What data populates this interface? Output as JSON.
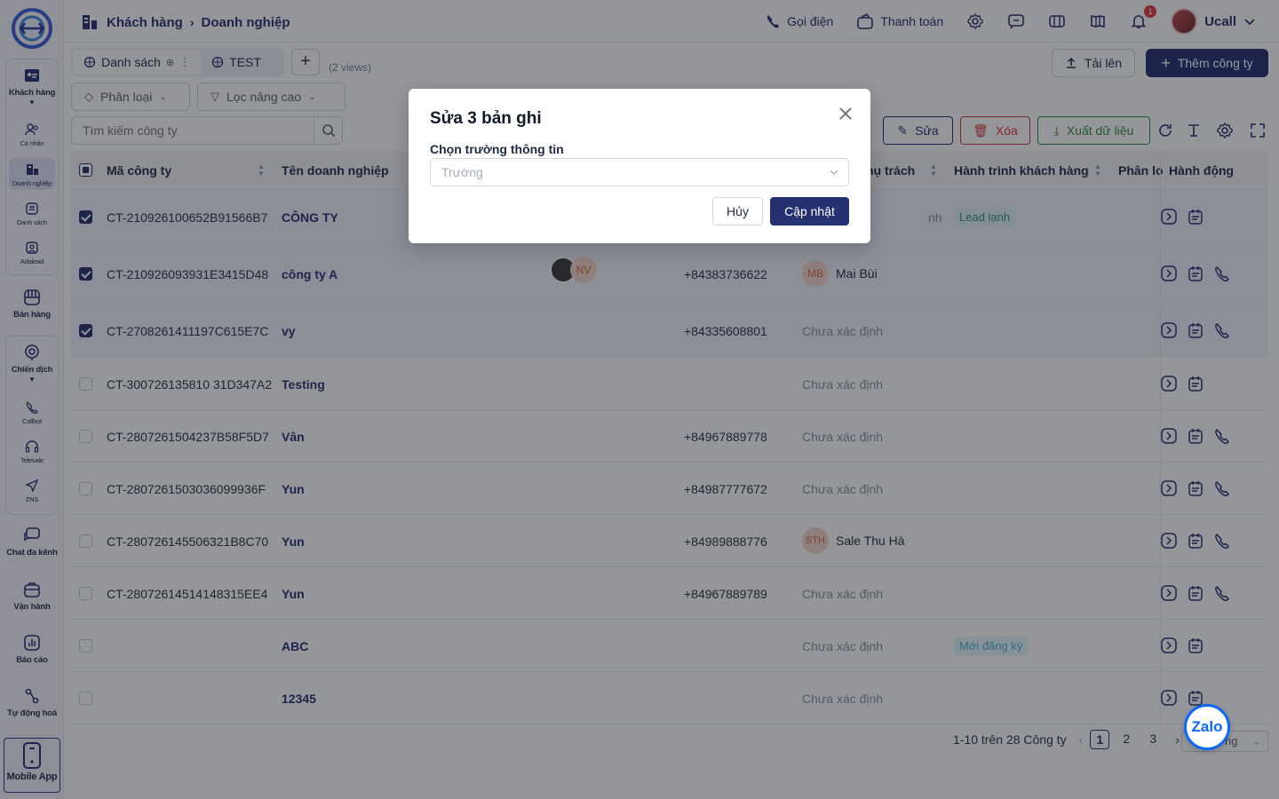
{
  "colors": {
    "primary": "#263171",
    "danger": "#d93636",
    "success": "#2e8b3d",
    "overlay": "rgba(20,22,30,0.45)"
  },
  "sidebar": {
    "items": [
      {
        "label": "Khách hàng",
        "icon": "contact-card-icon"
      },
      {
        "label": "Cá nhân",
        "icon": "users-icon"
      },
      {
        "label": "Doanh nghiệp",
        "icon": "building-icon"
      },
      {
        "label": "Danh sách",
        "icon": "list-icon"
      },
      {
        "label": "Adalead",
        "icon": "adalead-icon"
      },
      {
        "label": "Bán hàng",
        "icon": "store-icon"
      },
      {
        "label": "Chiến dịch",
        "icon": "campaign-icon"
      },
      {
        "label": "Callbot",
        "icon": "callbot-icon"
      },
      {
        "label": "Telesale",
        "icon": "headset-icon"
      },
      {
        "label": "ZNS",
        "icon": "send-icon"
      },
      {
        "label": "Chat đa kênh",
        "icon": "chat-icon"
      },
      {
        "label": "Vận hành",
        "icon": "briefcase-icon"
      },
      {
        "label": "Báo cáo",
        "icon": "report-icon"
      },
      {
        "label": "Tự động hoá",
        "icon": "automation-icon"
      },
      {
        "label": "Mobile App",
        "icon": "mobile-icon"
      }
    ]
  },
  "topbar": {
    "breadcrumb": [
      "Khách hàng",
      "Doanh nghiệp"
    ],
    "call_label": "Gọi điện",
    "payment_label": "Thanh toán",
    "notification_count": "1",
    "user_name": "Ucall"
  },
  "views": {
    "tabs": [
      "Danh sách",
      "TEST"
    ],
    "count_label": "(2 views)",
    "upload_label": "Tải lên",
    "add_label": "Thêm công ty"
  },
  "filters": {
    "category_label": "Phân loại",
    "advanced_label": "Lọc nâng cao",
    "search_placeholder": "Tìm kiếm công ty"
  },
  "bulk_actions": {
    "edit_label": "Sửa",
    "delete_label": "Xóa",
    "export_label": "Xuất dữ liệu"
  },
  "table": {
    "columns": [
      "Mã công ty",
      "Tên doanh nghiệp",
      "hụ trách",
      "Hành trình khách hàng",
      "Phân lo",
      "Hành động"
    ],
    "rows": [
      {
        "code": "CT-210926100652B91566B7",
        "name": "CÔNG TY",
        "phone": "",
        "owner": "nh",
        "owner_initials": "",
        "journey": "Lead lạnh",
        "selected": true,
        "call": false
      },
      {
        "code": "CT-210926093931E3415D48",
        "name": "công ty A",
        "phone": "+84383736622",
        "owner": "Mai Bùi",
        "owner_initials": "MB",
        "journey": "",
        "selected": true,
        "call": true
      },
      {
        "code": "CT-2708261411197C615E7C",
        "name": "vy",
        "phone": "+84335608801",
        "owner": "Chưa xác định",
        "owner_initials": "",
        "journey": "",
        "selected": true,
        "call": true
      },
      {
        "code": "CT-300726135810 31D347A2",
        "name": "Testing",
        "phone": "",
        "owner": "Chưa xác định",
        "owner_initials": "",
        "journey": "",
        "selected": false,
        "call": false
      },
      {
        "code": "CT-2807261504237B58F5D7",
        "name": "Vân",
        "phone": "+84967889778",
        "owner": "Chưa xác định",
        "owner_initials": "",
        "journey": "",
        "selected": false,
        "call": true
      },
      {
        "code": "CT-2807261503036099936F",
        "name": "Yun",
        "phone": "+84987777672",
        "owner": "Chưa xác định",
        "owner_initials": "",
        "journey": "",
        "selected": false,
        "call": true
      },
      {
        "code": "CT-280726145506321B8C70",
        "name": "Yun",
        "phone": "+84989888776",
        "owner": "Sale Thu Hà",
        "owner_initials": "STH",
        "journey": "",
        "selected": false,
        "call": true
      },
      {
        "code": "CT-28072614514148315EE4",
        "name": "Yun",
        "phone": "+84967889789",
        "owner": "Chưa xác định",
        "owner_initials": "",
        "journey": "",
        "selected": false,
        "call": true
      },
      {
        "code": "",
        "name": "ABC",
        "phone": "",
        "owner": "Chưa xác định",
        "owner_initials": "",
        "journey": "Mới đăng ký",
        "selected": false,
        "call": false
      },
      {
        "code": "",
        "name": "12345",
        "phone": "",
        "owner": "Chưa xác định",
        "owner_initials": "",
        "journey": "",
        "selected": false,
        "call": false
      }
    ],
    "row2_avatar": "NV"
  },
  "pagination": {
    "summary": "1-10 trên 28 Công ty",
    "pages": [
      "1",
      "2",
      "3"
    ],
    "per_page_suffix": "ng"
  },
  "modal": {
    "title": "Sửa 3 bản ghi",
    "field_label": "Chọn trường thông tin",
    "field_placeholder": "Trường",
    "cancel_label": "Hủy",
    "submit_label": "Cập nhật"
  },
  "zalo_label": "Zalo"
}
